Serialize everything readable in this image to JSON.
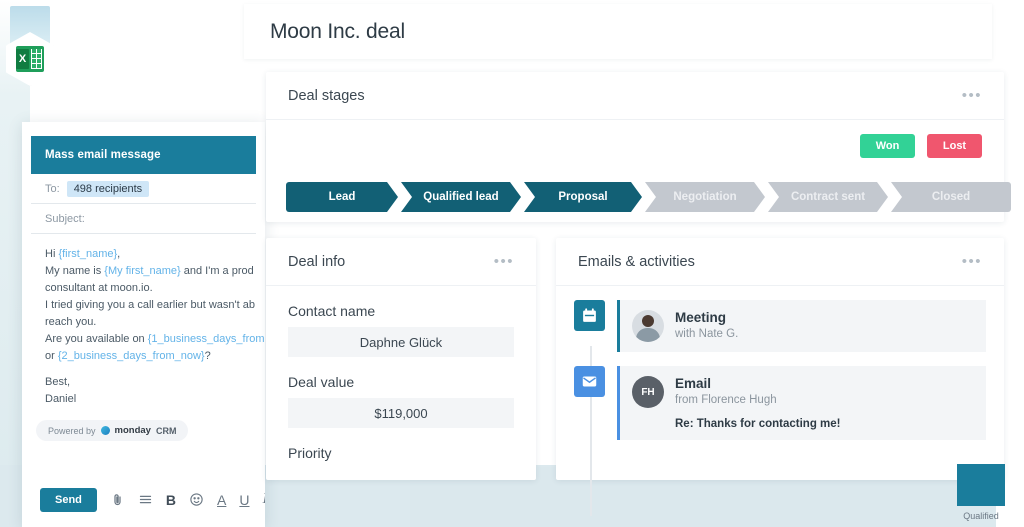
{
  "email_window": {
    "header_title": "Mass email message",
    "to_label": "To:",
    "recipients": "498 recipients",
    "subject_label": "Subject:",
    "body_lines": [
      {
        "id": "l1",
        "parts": [
          {
            "t": "Hi ",
            "tok": false
          },
          {
            "t": "{first_name}",
            "tok": true
          },
          {
            "t": ",",
            "tok": false
          }
        ]
      },
      {
        "id": "l2",
        "parts": [
          {
            "t": "My name is ",
            "tok": false
          },
          {
            "t": "{My first_name}",
            "tok": true
          },
          {
            "t": " and I'm a prod",
            "tok": false
          }
        ]
      },
      {
        "id": "l3",
        "parts": [
          {
            "t": "consultant at moon.io.",
            "tok": false
          }
        ]
      },
      {
        "id": "l4",
        "parts": [
          {
            "t": "I tried giving you a call earlier but wasn't ab",
            "tok": false
          }
        ]
      },
      {
        "id": "l5",
        "parts": [
          {
            "t": "reach you.",
            "tok": false
          }
        ]
      },
      {
        "id": "l6",
        "parts": [
          {
            "t": "Are you available on ",
            "tok": false
          },
          {
            "t": "{1_business_days_from",
            "tok": true
          }
        ]
      },
      {
        "id": "l7",
        "parts": [
          {
            "t": "or ",
            "tok": false
          },
          {
            "t": "{2_business_days_from_now}",
            "tok": true
          },
          {
            "t": "?",
            "tok": false
          }
        ]
      },
      {
        "id": "gap",
        "parts": []
      },
      {
        "id": "l8",
        "parts": [
          {
            "t": "Best,",
            "tok": false
          }
        ]
      },
      {
        "id": "l9",
        "parts": [
          {
            "t": "Daniel",
            "tok": false
          }
        ]
      }
    ],
    "powered_by": {
      "prefix": "Powered by",
      "brand": "monday",
      "suffix": "CRM"
    },
    "toolbar": {
      "send_label": "Send",
      "icons": [
        {
          "name": "attachment-icon",
          "glyph": "\u0001"
        },
        {
          "name": "bulleted-list-icon",
          "glyph": "≡"
        },
        {
          "name": "bold-icon",
          "glyph": "B"
        },
        {
          "name": "emoji-icon",
          "glyph": "☺"
        },
        {
          "name": "text-color-icon",
          "glyph": "A"
        },
        {
          "name": "underline-icon",
          "glyph": "U"
        },
        {
          "name": "italic-icon",
          "glyph": "I"
        }
      ]
    }
  },
  "deal_window": {
    "title": "Moon Inc. deal",
    "stages_card": {
      "title": "Deal stages",
      "won_label": "Won",
      "lost_label": "Lost",
      "won_color": "#32d296",
      "lost_color": "#f0566e",
      "active_color": "#126075",
      "inactive_color": "#c3c8cf",
      "stages": [
        {
          "label": "Lead",
          "active": true,
          "width": 112
        },
        {
          "label": "Qualified lead",
          "active": true,
          "width": 120
        },
        {
          "label": "Proposal",
          "active": true,
          "width": 118
        },
        {
          "label": "Negotiation",
          "active": false,
          "width": 120
        },
        {
          "label": "Contract sent",
          "active": false,
          "width": 120
        },
        {
          "label": "Closed",
          "active": false,
          "width": 120
        }
      ]
    },
    "info_card": {
      "title": "Deal info",
      "fields": [
        {
          "name": "Contact name",
          "value": "Daphne Glück"
        },
        {
          "name": "Deal value",
          "value": "$119,000"
        },
        {
          "name": "Priority",
          "value": ""
        }
      ]
    },
    "activities_card": {
      "title": "Emails & activities",
      "items": [
        {
          "kind": "meeting",
          "icon": "calendar-icon",
          "icon_color": "#1a7d9c",
          "title": "Meeting",
          "subtitle": "with Nate G.",
          "avatar_type": "photo",
          "avatar_initials": "",
          "snippet": ""
        },
        {
          "kind": "email",
          "icon": "envelope-icon",
          "icon_color": "#4a90e2",
          "title": "Email",
          "subtitle": "from Florence Hugh",
          "avatar_type": "initials",
          "avatar_initials": "FH",
          "snippet": "Re: Thanks for contacting me!"
        }
      ]
    }
  },
  "desktop": {
    "excel_badge_letter": "X",
    "qualified_label": "Qualified",
    "qualified_color": "#1a7d9c"
  }
}
